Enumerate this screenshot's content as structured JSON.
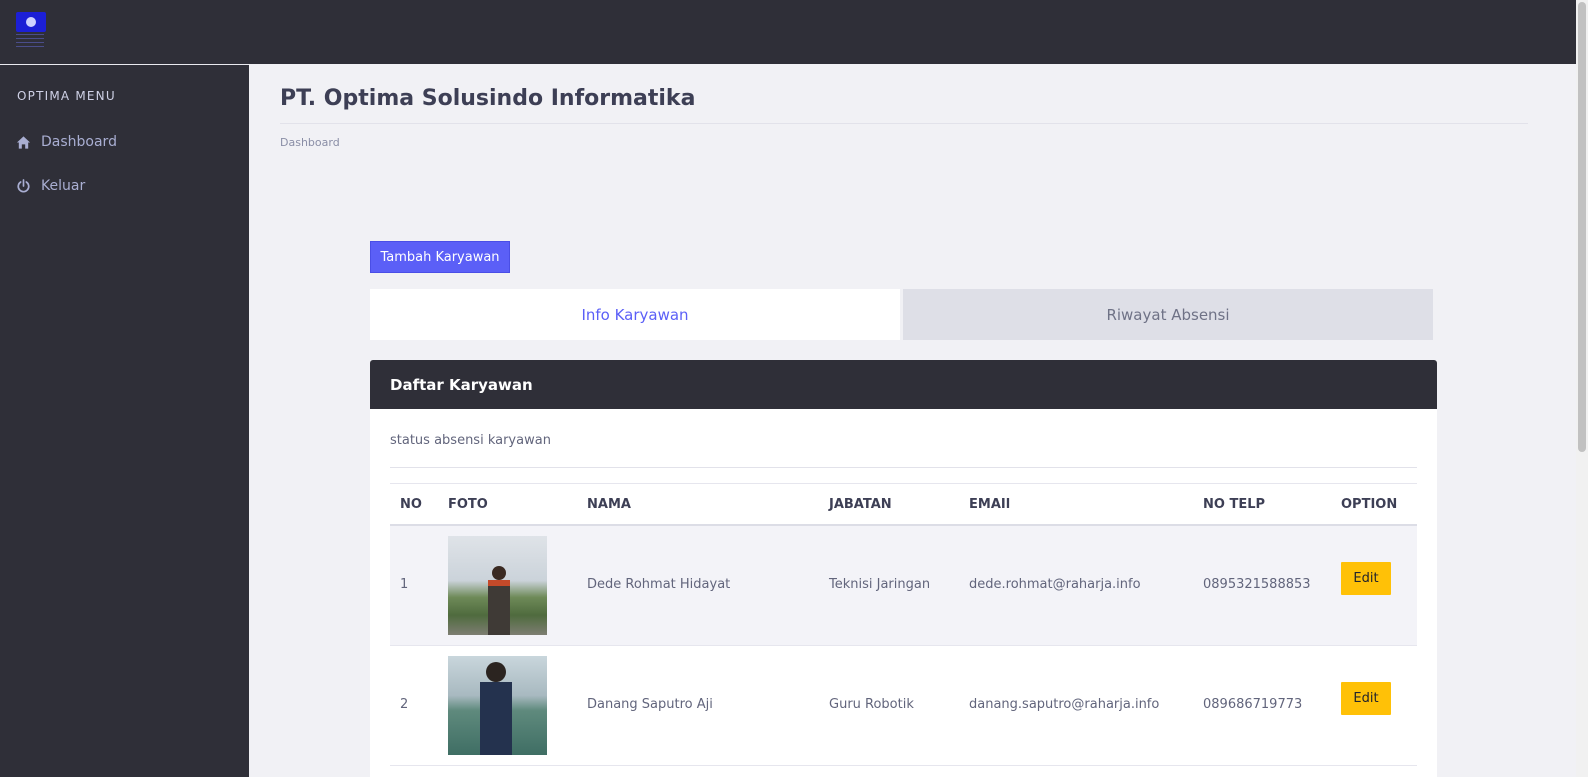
{
  "sidebar": {
    "menu_title": "OPTIMA MENU",
    "items": [
      {
        "label": "Dashboard",
        "icon": "home-icon"
      },
      {
        "label": "Keluar",
        "icon": "power-icon"
      }
    ]
  },
  "header": {
    "title": "PT. Optima Solusindo Informatika",
    "breadcrumb": "Dashboard"
  },
  "actions": {
    "add_label": "Tambah Karyawan"
  },
  "tabs": [
    {
      "label": "Info Karyawan",
      "active": true
    },
    {
      "label": "Riwayat Absensi",
      "active": false
    }
  ],
  "card": {
    "title": "Daftar Karyawan",
    "subtitle": "status absensi karyawan"
  },
  "table": {
    "columns": [
      "NO",
      "FOTO",
      "NAMA",
      "JABATAN",
      "EMAIl",
      "NO TELP",
      "OPTION"
    ],
    "rows": [
      {
        "no": "1",
        "nama": "Dede Rohmat Hidayat",
        "jabatan": "Teknisi Jaringan",
        "email": "dede.rohmat@raharja.info",
        "telp": "0895321588853",
        "option": "Edit"
      },
      {
        "no": "2",
        "nama": "Danang Saputro Aji",
        "jabatan": "Guru Robotik",
        "email": "danang.saputro@raharja.info",
        "telp": "089686719773",
        "option": "Edit"
      }
    ]
  },
  "colors": {
    "sidebar_bg": "#2f2f38",
    "accent": "#5b5ff7",
    "edit_button": "#ffc107",
    "page_bg": "#f1f1f5"
  }
}
